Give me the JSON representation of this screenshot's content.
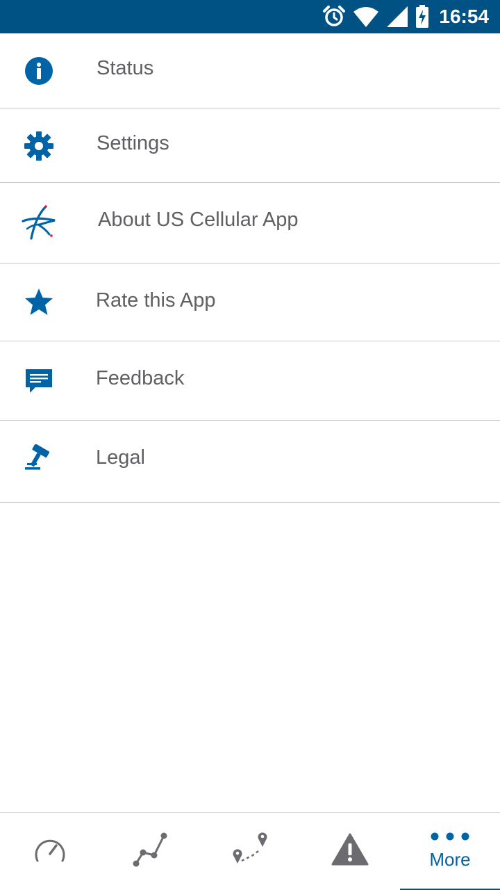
{
  "status_bar": {
    "time": "16:54",
    "icons": [
      "alarm-icon",
      "wifi-icon",
      "signal-icon",
      "battery-charging-icon"
    ],
    "background": "#005285"
  },
  "menu": {
    "items": [
      {
        "label": "Status",
        "icon": "info-icon"
      },
      {
        "label": "Settings",
        "icon": "gear-icon"
      },
      {
        "label": "About US Cellular App",
        "icon": "uscellular-logo-icon"
      },
      {
        "label": "Rate this App",
        "icon": "star-icon"
      },
      {
        "label": "Feedback",
        "icon": "chat-bubble-icon"
      },
      {
        "label": "Legal",
        "icon": "gavel-icon"
      }
    ],
    "icon_color": "#0063a5",
    "label_color": "#5f5f64"
  },
  "bottom_nav": {
    "items": [
      {
        "icon": "speedometer-icon"
      },
      {
        "icon": "chart-line-icon"
      },
      {
        "icon": "route-map-icon"
      },
      {
        "icon": "warning-icon"
      },
      {
        "icon": "more-dots-icon",
        "label": "More",
        "active": true
      }
    ],
    "active_color": "#0063a5",
    "inactive_color": "#6b6b70"
  }
}
